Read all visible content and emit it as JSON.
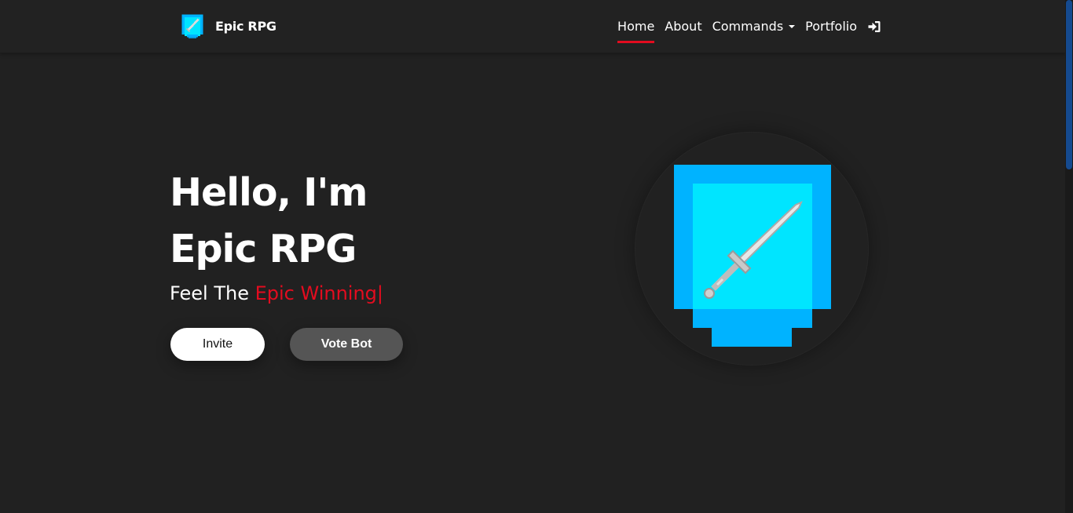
{
  "navbar": {
    "brand_name": "Epic RPG",
    "links": [
      {
        "label": "Home",
        "active": true
      },
      {
        "label": "About"
      },
      {
        "label": "Commands",
        "dropdown": true
      },
      {
        "label": "Portfolio"
      }
    ],
    "login_icon": "sign-in-icon",
    "accent_color": "#e30c1f"
  },
  "hero": {
    "greeting": "Hello, I'm",
    "name": "Epic RPG",
    "tagline_prefix": "Feel The",
    "tagline_highlight": "Epic Winning|",
    "buttons": {
      "invite": "Invite",
      "vote": "Vote Bot"
    },
    "image_icon": "sword-shield-icon"
  },
  "colors": {
    "background": "#212121",
    "accent": "#e30c1f",
    "logo_cyan": "#00e5ff",
    "logo_blue": "#00b3ff"
  }
}
